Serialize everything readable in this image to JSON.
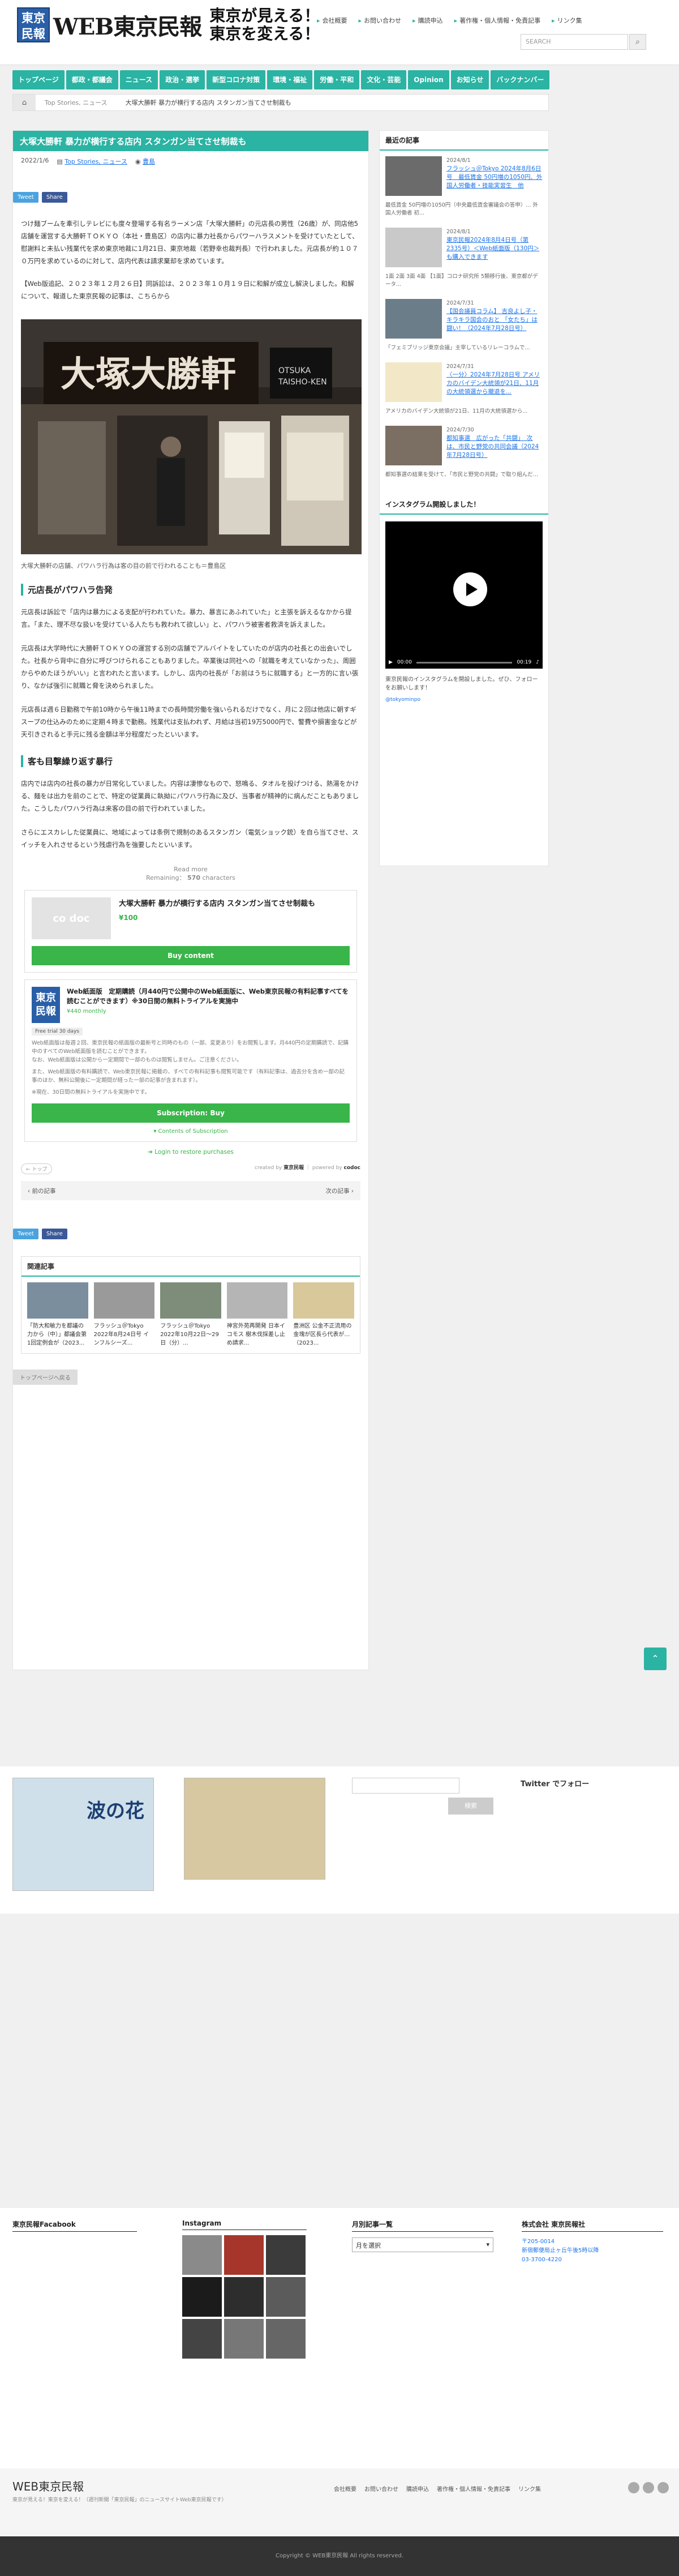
{
  "header": {
    "logo_badge": "東京\n民報",
    "logo_text": "WEB東京民報",
    "slogan_line1": "東京が見える！",
    "slogan_line2": "東京を変える！",
    "topnav": [
      "会社概要",
      "お問い合わせ",
      "購読申込",
      "著作権・個人情報・免責記事",
      "リンク集"
    ],
    "search_placeholder": "SEARCH"
  },
  "gnav": [
    "トップページ",
    "都政・都議会",
    "ニュース",
    "政治・選挙",
    "新型コロナ対策",
    "環境・福祉",
    "労働・平和",
    "文化・芸能",
    "Opinion",
    "お知らせ",
    "バックナンバー"
  ],
  "breadcrumb": {
    "home": "⌂",
    "seg1": "Top Stories, ニュース",
    "current": "大塚大勝軒 暴力が横行する店内 スタンガン当てさせ制裁も"
  },
  "article": {
    "title": "大塚大勝軒 暴力が横行する店内 スタンガン当てさせ制裁も",
    "date": "2022/1/6",
    "categories": "Top Stories, ニュース",
    "author": "豊島",
    "tweet": "Tweet",
    "share": "Share",
    "p1": "つけ麺ブームを牽引しテレビにも度々登場する有名ラーメン店「大塚大勝軒」の元店長の男性（26歳）が、同店他5店舗を運営する大勝軒ＴＯＫＹＯ（本社・豊島区）の店内に暴力社長からパワーハラスメントを受けていたとして、慰謝料と未払い残業代を求め東京地裁に1月21日、東京地裁（若野幸也裁判長）で行われました。元店長が約１０７０万円を求めているのに対して、店内代表は請求棄却を求めています。",
    "p2": "【Web版追記、２０２３年１２月２６日】同訴訟は、２０２３年１０月１９日に和解が成立し解決しました。和解について、報道した東京民報の記事は、こちらから",
    "photo_caption": "大塚大勝軒の店舗、パワハラ行為は客の目の前で行われることも＝豊島区",
    "h_sub1": "元店長がパワハラ告発",
    "p3": "元店長は訴訟で「店内は暴力による支配が行われていた。暴力、暴言にあふれていた」と主張を訴えるなかから提言。「また、理不尽な扱いを受けている人たちも救われて欲しい」と、パワハラ被害者救済を訴えました。",
    "p4": "元店長は大学時代に大勝軒ＴＯＫＹＯの運営する別の店舗でアルバイトをしていたのが店内の社長との出会いでした。社長から背中に自分に呼びつけられることもありました。卒業後は同社への「就職を考えていなかった」、周囲からやめたほうがいい」と言われたと言います。しかし、店内の社長が「お前はうちに就職する」と一方的に言い張り、なかば強引に就職と脅を決められました。",
    "p5": "元店長は週６日勤務で午前10時から午後11時までの長時間労働を強いられるだけでなく、月に２回は他店に朝すギスープの仕込みのために定期４時まで勤務。残業代は支払われず、月給は当初19万5000円で、警費や損害金などが天引きされると手元に残る金額は半分程度だったといいます。",
    "h_sub2": "客も目撃繰り返す暴行",
    "p6": "店内では店内の社長の暴力が日常化していました。内容は凄惨なもので、怒鳴る、タオルを投げつける、熱湯をかける、麺をは出力を前のことで、特定の従業員に執拗にパワハラ行為に及び、当事者が精神的に病んだこともありました。こうしたパワハラ行為は来客の目の前で行われていました。",
    "p7": "さらにエスカレした従業員に、地域によっては条例で規制のあるスタンガン（電気ショック銃）を自ら当てさせ、スイッチを入れさせるという残虐行為を強要したといいます。",
    "readmore": "Read more",
    "remaining": "Remaining：",
    "remaining_num": "570",
    "remaining_unit": "characters",
    "product_title": "大塚大勝軒 暴力が横行する店内 スタンガン当てさせ制裁も",
    "product_price": "¥100",
    "product_thumb": "co doc",
    "buy": "Buy content",
    "sub_title": "Web紙面版　定期購読（月440円で公開中のWeb紙面版に、Web東京民報の有料記事すべてを読むことができます）※30日間の無料トライアルを実施中",
    "sub_price": "¥440 monthly",
    "sub_badge": "Free trial 30 days",
    "sub_desc1": "Web紙面版は毎週２回、東京民報の紙面版の最新号と同時のもの（一部、変更あり）をお閲覧します。月440円の定期購読で、記購中のすべてのWeb紙面版を読むことができます。",
    "sub_desc2": "なお、Web紙面版は公開から一定期間で一部のものは閲覧しません。ご注意ください。",
    "sub_desc3": "また、Web紙面版の有料購読で、Web東京民報に掲載の、すべての有料記事も閲覧可能です（有料記事は、過去分を含め一部の記事のほか、無料公開後に一定期間が経った一部の記事が含まれます）。",
    "sub_desc4": "※現在、30日間の無料トライアルを実施中です。",
    "sub_btn": "Subscription: Buy",
    "sub_contents": "Contents of Subscription",
    "login": "Login to restore purchases",
    "tag_back": "← トップ",
    "created_by": "created by",
    "created_name": "東京民報",
    "powered_by": "powered by",
    "powered_name": "codoc",
    "prev": "前の記事",
    "next": "次の記事",
    "related_heading": "関連記事",
    "related": [
      {
        "title": "「防大和敏力を都議の力から（中）」都議会第1回定例会が（2023..."
      },
      {
        "title": "フラッシュ＠Tokyo 2022年8月24日号 インフルシーズ..."
      },
      {
        "title": "フラッシュ＠Tokyo 2022年10月22日～29日（分）..."
      },
      {
        "title": "神宮外苑再開発 日本イコモス 樹木伐採差し止め請求..."
      },
      {
        "title": "豊洲区 公金不正流用の金塊が区長ら代表が…（2023..."
      }
    ],
    "to_top": "トップページへ戻る"
  },
  "sidebar": {
    "heading": "最近の記事",
    "items": [
      {
        "date": "2024/8/1",
        "title": "フラッシュ＠Tokyo 2024年8月6日号　最低賃金 50円増の1050円、外国人労働者・技能実習生　他",
        "excerpt": "最低賃金 50円増の1050円（中央最低賃金審議会の答申）... 外国人労働者 初..."
      },
      {
        "date": "2024/8/1",
        "title": "東京民報2024年8月4日号（第2335号）＜Web紙面版（130円＞も購入できます",
        "excerpt": "1面 2面 3面 4面 【1面】コロナ研究所 5類移行後、東京都がデータ..."
      },
      {
        "date": "2024/7/31",
        "title": "【国会議員コラム】 吉良よし子・キラキラ国会のおと 「女たち」は闘い！（2024年7月28日号）",
        "excerpt": "「フェミブリッジ東京会議」主宰しているリレーコラムで..."
      },
      {
        "date": "2024/7/31",
        "title": "〈一分〉2024年7月28日号 アメリカのバイデン大統領が21日、11月の大統領選から撤退を...",
        "excerpt": "アメリカのバイデン大統領が21日、11月の大統領選から..."
      },
      {
        "date": "2024/7/30",
        "title": "都知事選　広がった「共闘」　次は、市民と野党の共同会議（2024年7月28日号）",
        "excerpt": "都知事選の結果を受けて、「市民と野党の共闘」で取り組んだ..."
      }
    ],
    "insta_heading": "インスタグラム開設しました！",
    "insta_text": "東京民報のインスタグラムを開設しました。ぜひ、フォローをお願いします！",
    "insta_user": "@tokyominpo",
    "video_time": "00:00",
    "video_dur": "00:19"
  },
  "footer_widgets": {
    "banner1_title": "波の花",
    "banner2_title": "",
    "twitter_heading": "Twitter でフォロー",
    "search_btn": "検索",
    "fb_heading": "東京民報Facabook",
    "insta_heading": "Instagram",
    "archive_heading": "月別記事一覧",
    "archive_select": "月を選択",
    "company_heading": "株式会社 東京民報社",
    "company_zip": "〒205-0014",
    "company_addr": "新宿郵便局止ヶ丘午後5時以降",
    "company_tel": "03-3700-4220"
  },
  "footer": {
    "logo": "WEB東京民報",
    "tagline": "東京が見える！東京を変える！（週刊新聞「東京民報」のニュースサイトWeb東京民報です）",
    "links": [
      "会社概要",
      "お問い合わせ",
      "購読申込",
      "著作権・個人情報・免責記事",
      "リンク集"
    ],
    "copyright": "Copyright © WEB東京民報 All rights reserved."
  }
}
